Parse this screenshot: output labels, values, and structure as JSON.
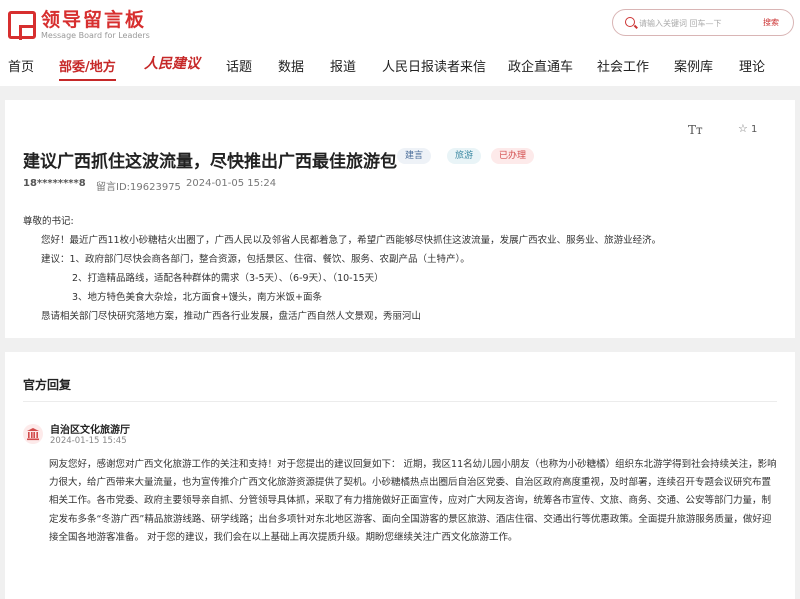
{
  "header": {
    "logo_cn": "领导留言板",
    "logo_en": "Message Board for Leaders",
    "search_placeholder": "请输入关键词 回车—下",
    "search_button": "搜索"
  },
  "nav": {
    "items": [
      "首页",
      "部委/地方",
      "人民建议",
      "话题",
      "数据",
      "报道",
      "人民日报读者来信",
      "政企直通车",
      "社会工作",
      "案例库",
      "理论"
    ]
  },
  "suggestion": {
    "title": "建议广西抓住这波流量，尽快推出广西最佳旅游包",
    "tags": [
      "建言",
      "旅游",
      "已办理"
    ],
    "author": "18********8",
    "message_id": "留言ID:19623975",
    "date": "2024-01-05 15:24",
    "font_toggle": "Tт",
    "star_count": "1",
    "body": [
      "尊敬的书记:",
      "您好！最近广西11枚小砂糖桔火出圈了，广西人民以及邻省人民都着急了，希望广西能够尽快抓住这波流量，发展广西农业、服务业、旅游业经济。",
      "建议：1、政府部门尽快会商各部门，整合资源，包括景区、住宿、餐饮、服务、农副产品（土特产）。",
      "2、打造精品路线，适配各种群体的需求（3-5天）、（6-9天）、（10-15天）",
      "3、地方特色美食大杂烩，北方面食+馒头，南方米饭+面条",
      "恳请相关部门尽快研究落地方案，推动广西各行业发展，盘活广西自然人文景观，秀丽河山"
    ]
  },
  "reply": {
    "heading": "官方回复",
    "org_name": "自治区文化旅游厅",
    "date": "2024-01-15 15:45",
    "body": "网友您好，感谢您对广西文化旅游工作的关注和支持！对于您提出的建议回复如下：  近期，我区11名幼儿园小朋友（也称为小砂糖橘）组织东北游学得到社会持续关注，影响力很大，给广西带来大量流量，也为宣传推介广西文化旅游资源提供了契机。小砂糖橘热点出圈后自治区党委、自治区政府高度重视，及时部署，连续召开专题会议研究布置相关工作。各市党委、政府主要领导亲自抓、分管领导具体抓，采取了有力措施做好正面宣传，应对广大网友咨询，统筹各市宣传、文旅、商务、交通、公安等部门力量，制定发布多条“冬游广西”精品旅游线路、研学线路；出台多项针对东北地区游客、面向全国游客的景区旅游、酒店住宿、交通出行等优惠政策。全面提升旅游服务质量，做好迎接全国各地游客准备。 对于您的建议，我们会在以上基础上再次提质升级。期盼您继续关注广西文化旅游工作。"
  },
  "colors": {
    "brand_red": "#c62828",
    "tag_done": "#d24b4b"
  }
}
